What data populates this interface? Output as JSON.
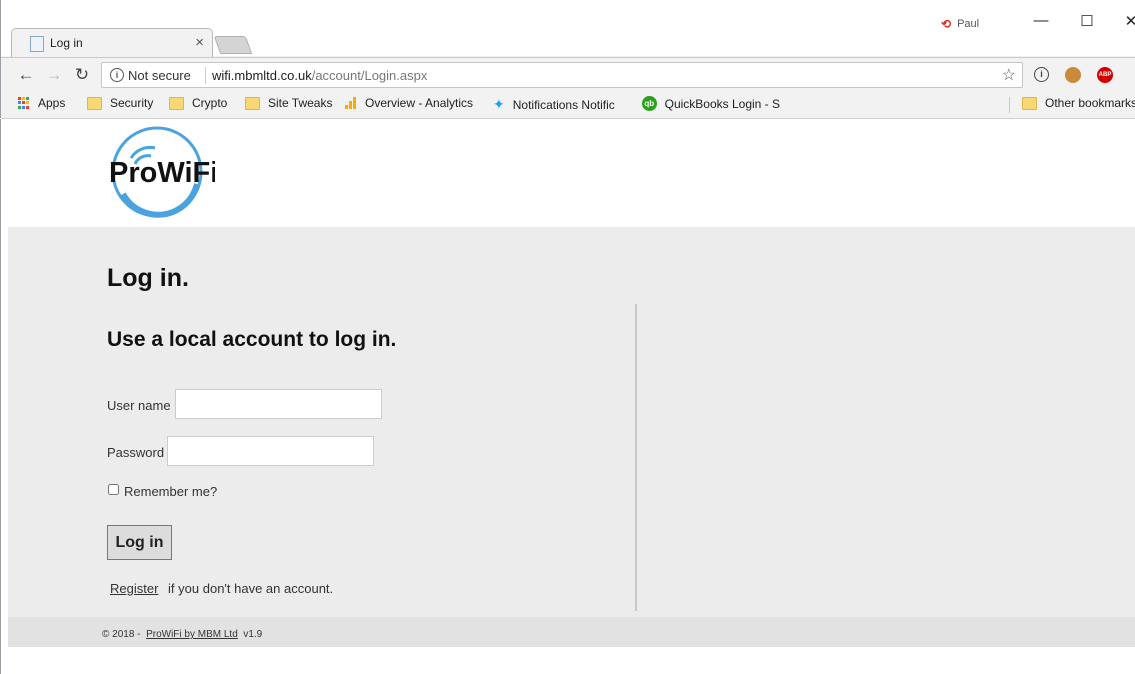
{
  "browser": {
    "tab_title": "Log in",
    "tab_close": "×",
    "profile_name": "Paul",
    "controls": {
      "minimize": "—",
      "maximize": "☐",
      "close": "✕"
    },
    "nav": {
      "back": "←",
      "forward": "→",
      "reload": "↻"
    },
    "address": {
      "security": "Not secure",
      "host": "wifi.mbmltd.co.uk",
      "path": "/account/Login.aspx"
    },
    "extensions": [
      {
        "name": "1password",
        "glyph": "ⓘ",
        "color": "#444444"
      },
      {
        "name": "cookie",
        "glyph": "●",
        "color": "#c98a3b"
      },
      {
        "name": "adblock",
        "glyph": "ABP",
        "color": "#d40000"
      }
    ],
    "bookmarks": [
      {
        "label": "Apps",
        "icon": "apps"
      },
      {
        "label": "Security",
        "icon": "folder"
      },
      {
        "label": "Crypto",
        "icon": "folder"
      },
      {
        "label": "Site Tweaks",
        "icon": "folder"
      },
      {
        "label": "Overview - Analytics",
        "icon": "analytics"
      },
      {
        "label": "Notifications Notific",
        "icon": "twitter"
      },
      {
        "label": "QuickBooks Login - S",
        "icon": "quickbooks"
      },
      {
        "label": "Other bookmarks",
        "icon": "folder"
      }
    ]
  },
  "site": {
    "logo_text": "ProWiFi",
    "logo_color": "#4aa3df"
  },
  "login": {
    "page_title": "Log in.",
    "subtitle": "Use a local account to log in.",
    "username_label": "User name",
    "username_value": "",
    "password_label": "Password",
    "password_value": "",
    "remember_label": "Remember me?",
    "remember_checked": false,
    "submit_label": "Log in",
    "register_link": "Register",
    "register_suffix": "if you don't have an account."
  },
  "footer": {
    "prefix": "© 2018 -",
    "link": "ProWiFi by MBM Ltd",
    "version": "v1.9"
  }
}
